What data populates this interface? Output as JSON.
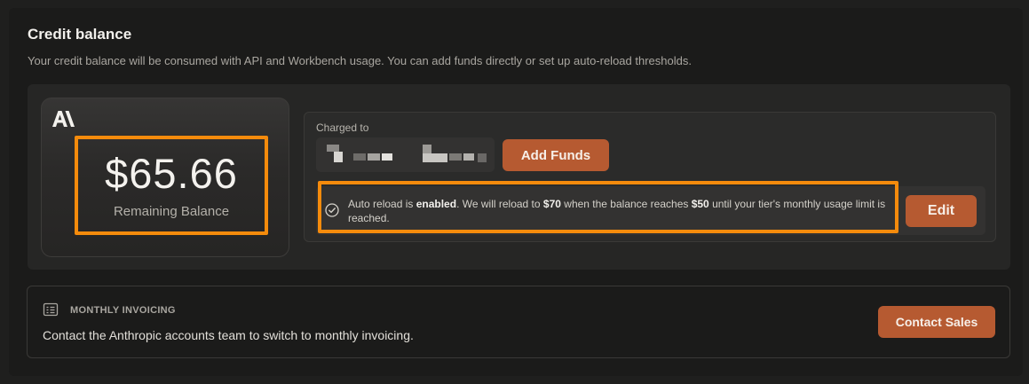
{
  "header": {
    "title": "Credit balance",
    "subtitle": "Your credit balance will be consumed with API and Workbench usage. You can add funds directly or set up auto-reload thresholds."
  },
  "balance": {
    "logo_icon": "anthropic-logo-icon",
    "amount": "$65.66",
    "label": "Remaining Balance"
  },
  "charge": {
    "label": "Charged to",
    "account_value_redacted": true,
    "add_funds_label": "Add Funds"
  },
  "auto_reload": {
    "icon": "check-circle-icon",
    "text_1": "Auto reload is ",
    "status": "enabled",
    "text_2": ". We will reload to ",
    "reload_amount": "$70",
    "text_3": " when the balance reaches ",
    "threshold": "$50",
    "text_4": " until your tier's monthly usage limit is reached.",
    "edit_label": "Edit"
  },
  "invoicing": {
    "icon": "invoice-icon",
    "title": "MONTHLY INVOICING",
    "text": "Contact the Anthropic accounts team to switch to monthly invoicing.",
    "button_label": "Contact Sales"
  },
  "colors": {
    "accent": "#b65a31",
    "highlight": "#f58b0c",
    "background": "#1b1b1a"
  }
}
